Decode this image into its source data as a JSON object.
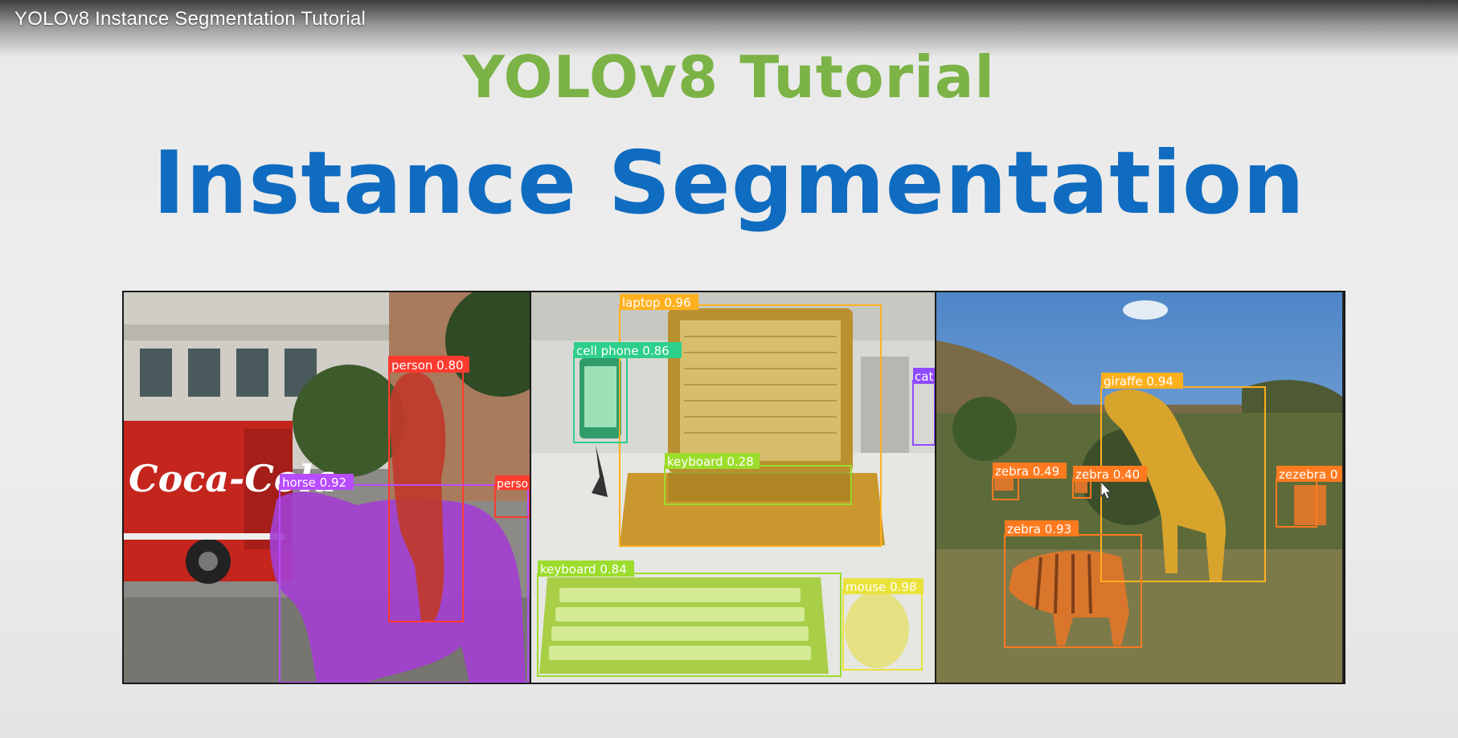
{
  "video": {
    "title": "YOLOv8 Instance Segmentation Tutorial"
  },
  "slide": {
    "subtitle": "YOLOv8 Tutorial",
    "title": "Instance Segmentation",
    "colors": {
      "subtitle": "#7bb346",
      "title": "#0f6cc0"
    }
  },
  "panels": [
    {
      "scene": "street",
      "detections": [
        {
          "label": "person 0.80",
          "color": "#ff3b30"
        },
        {
          "label": "horse 0.92",
          "color": "#b84cff"
        },
        {
          "label": "perso",
          "color": "#ff3b30"
        }
      ],
      "sign_text": "Coca-Cola"
    },
    {
      "scene": "desk",
      "detections": [
        {
          "label": "laptop 0.96",
          "color": "#ffb01f"
        },
        {
          "label": "cell phone 0.86",
          "color": "#2ecf8a"
        },
        {
          "label": "keyboard 0.28",
          "color": "#9cdc2c"
        },
        {
          "label": "keyboard 0.84",
          "color": "#9cdc2c"
        },
        {
          "label": "mouse 0.98",
          "color": "#e9e23a"
        },
        {
          "label": "cat",
          "color": "#8f4cff"
        }
      ]
    },
    {
      "scene": "savanna",
      "detections": [
        {
          "label": "giraffe 0.94",
          "color": "#ffb01f"
        },
        {
          "label": "zebra 0.49",
          "color": "#ff7a1f"
        },
        {
          "label": "zebra 0.40",
          "color": "#ff7a1f"
        },
        {
          "label": "zebra 0.93",
          "color": "#ff7a1f"
        },
        {
          "label": "zezebra 0",
          "color": "#ff7a1f"
        }
      ]
    }
  ]
}
